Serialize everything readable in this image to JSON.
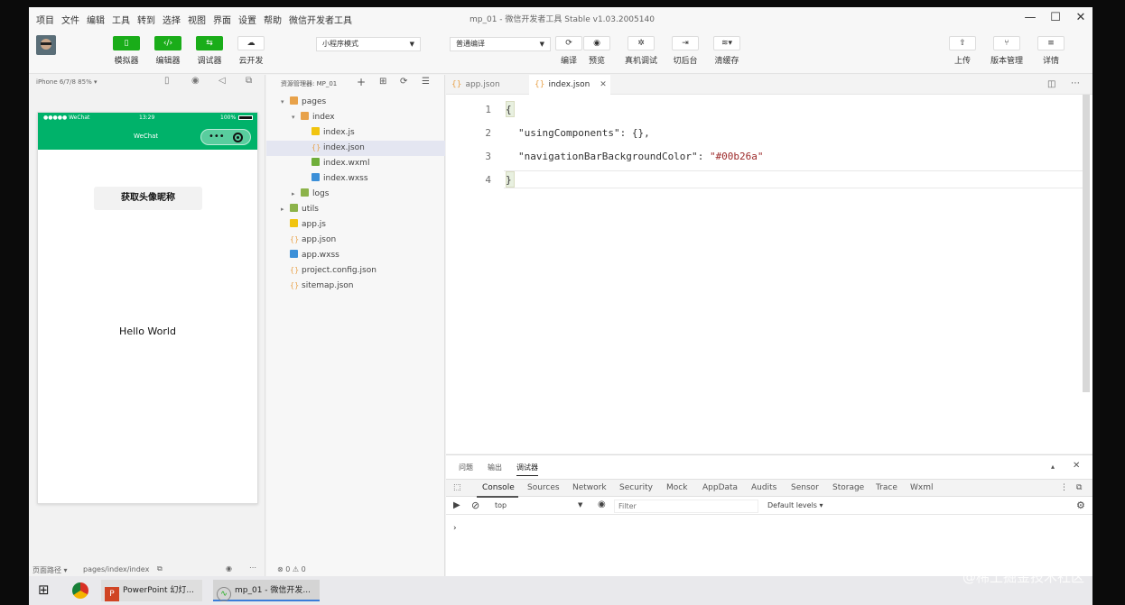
{
  "window": {
    "menus": [
      "项目",
      "文件",
      "编辑",
      "工具",
      "转到",
      "选择",
      "视图",
      "界面",
      "设置",
      "帮助",
      "微信开发者工具"
    ],
    "title": "mp_01 - 微信开发者工具 Stable v1.03.2005140"
  },
  "toolbar": {
    "simulator_label": "模拟器",
    "editor_label": "编辑器",
    "debugger_label": "调试器",
    "cloud_label": "云开发",
    "mode_select": "小程序模式",
    "compile_select": "普通编译",
    "compile_label": "编译",
    "preview_label": "预览",
    "realdevice_label": "真机调试",
    "background_label": "切后台",
    "clearcache_label": "清缓存",
    "upload_label": "上传",
    "version_label": "版本管理",
    "details_label": "详情"
  },
  "simulator": {
    "device": "iPhone 6/7/8 85% ▾",
    "status_left": "●●●●● WeChat",
    "status_time": "13:29",
    "status_right": "100%",
    "nav_title": "WeChat",
    "nav_color": "#00b26a",
    "button_text": "获取头像昵称",
    "hello_text": "Hello World",
    "footer_path_label": "页面路径 ▾",
    "footer_path": "pages/index/index"
  },
  "explorer": {
    "header": "资源管理器: MP_01",
    "items": [
      {
        "label": "pages",
        "depth": 0,
        "type": "folder",
        "open": true
      },
      {
        "label": "index",
        "depth": 1,
        "type": "folder",
        "open": true
      },
      {
        "label": "index.js",
        "depth": 2,
        "type": "js"
      },
      {
        "label": "index.json",
        "depth": 2,
        "type": "json",
        "selected": true
      },
      {
        "label": "index.wxml",
        "depth": 2,
        "type": "wxml"
      },
      {
        "label": "index.wxss",
        "depth": 2,
        "type": "wxss"
      },
      {
        "label": "logs",
        "depth": 1,
        "type": "gfolder",
        "open": false
      },
      {
        "label": "utils",
        "depth": 0,
        "type": "gfolder",
        "open": false
      },
      {
        "label": "app.js",
        "depth": 0,
        "type": "js"
      },
      {
        "label": "app.json",
        "depth": 0,
        "type": "json"
      },
      {
        "label": "app.wxss",
        "depth": 0,
        "type": "wxss"
      },
      {
        "label": "project.config.json",
        "depth": 0,
        "type": "json"
      },
      {
        "label": "sitemap.json",
        "depth": 0,
        "type": "json"
      }
    ],
    "footer_status": "⊗ 0 ⚠ 0"
  },
  "editor": {
    "tabs": [
      {
        "label": "app.json",
        "active": false
      },
      {
        "label": "index.json",
        "active": true
      }
    ],
    "line_numbers": [
      "1",
      "2",
      "3",
      "4"
    ],
    "line1": "{",
    "line2_key": "\"usingComponents\"",
    "line2_rest": ": {},",
    "line3_key": "\"navigationBarBackgroundColor\"",
    "line3_sep": ": ",
    "line3_value": "\"#00b26a\"",
    "line4": "}"
  },
  "devtools": {
    "main_tabs": [
      "问题",
      "输出",
      "调试器"
    ],
    "tabs": [
      "Console",
      "Sources",
      "Network",
      "Security",
      "Mock",
      "AppData",
      "Audits",
      "Sensor",
      "Storage",
      "Trace",
      "Wxml"
    ],
    "context": "top",
    "filter_placeholder": "Filter",
    "levels": "Default levels ▾",
    "prompt": "›"
  },
  "taskbar": {
    "powerpoint": "PowerPoint 幻灯...",
    "devtool": "mp_01 - 微信开发..."
  },
  "watermark": "@稀土掘金技术社区"
}
